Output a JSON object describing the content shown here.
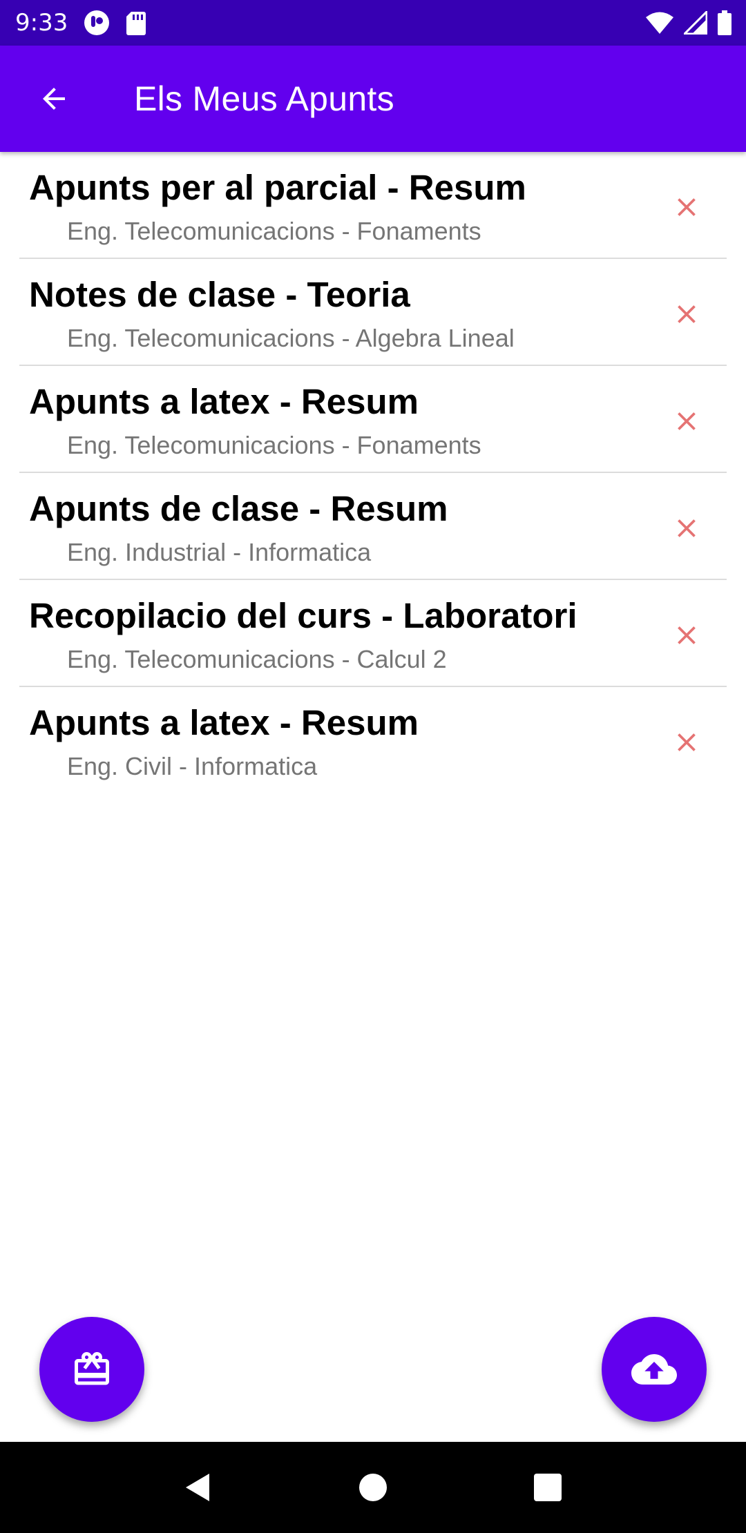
{
  "status_bar": {
    "time": "9:33",
    "left_icons": [
      "assistant-icon",
      "sd-card-icon"
    ],
    "right_icons": [
      "wifi-icon",
      "signal-icon",
      "battery-icon"
    ]
  },
  "app_bar": {
    "title": "Els Meus Apunts",
    "back_icon": "arrow-back-icon"
  },
  "notes": [
    {
      "title": "Apunts per al parcial - Resum",
      "subtitle": "Eng. Telecomunicacions - Fonaments"
    },
    {
      "title": "Notes de clase - Teoria",
      "subtitle": "Eng. Telecomunicacions - Algebra Lineal"
    },
    {
      "title": "Apunts a latex - Resum",
      "subtitle": "Eng. Telecomunicacions - Fonaments"
    },
    {
      "title": "Apunts de clase - Resum",
      "subtitle": "Eng. Industrial - Informatica"
    },
    {
      "title": "Recopilacio del curs - Laboratori",
      "subtitle": "Eng. Telecomunicacions - Calcul 2"
    },
    {
      "title": "Apunts a latex - Resum",
      "subtitle": "Eng. Civil - Informatica"
    }
  ],
  "fabs": {
    "left_icon": "card-giftcard-icon",
    "right_icon": "cloud-upload-icon"
  },
  "nav_bar": {
    "icons": [
      "back-triangle-icon",
      "home-circle-icon",
      "recents-square-icon"
    ]
  },
  "colors": {
    "status_bar": "#3700b3",
    "primary": "#6200ee",
    "delete_icon": "#e57373",
    "subtitle_text": "#757575"
  }
}
